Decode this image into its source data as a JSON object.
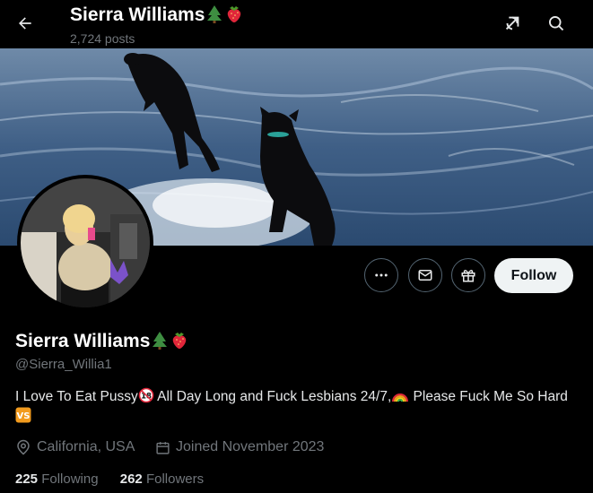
{
  "header": {
    "title": "Sierra Williams",
    "posts": "2,724 posts"
  },
  "icons": {
    "back": "arrow-left-icon",
    "grok": "grok-icon",
    "search": "search-icon",
    "more": "more-icon",
    "message": "message-icon",
    "gift": "gift-icon",
    "location": "location-pin-icon",
    "calendar": "calendar-icon"
  },
  "profile": {
    "name": "Sierra Williams",
    "handle": "@Sierra_Willia1",
    "bio_part1": "I Love To Eat Pussy",
    "bio_part2": " All Day Long and Fuck Lesbians 24/7,",
    "bio_part3": " Please Fuck Me So Hard",
    "location": "California, USA",
    "joined": "Joined November 2023",
    "following_count": "225",
    "following_label": "Following",
    "followers_count": "262",
    "followers_label": "Followers"
  },
  "actions": {
    "follow": "Follow"
  },
  "colors": {
    "background": "#000000",
    "muted": "#71767b",
    "follow_bg": "#eff3f4",
    "border": "#536471"
  }
}
